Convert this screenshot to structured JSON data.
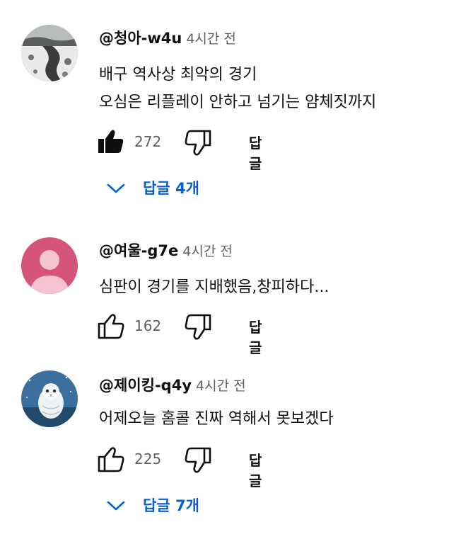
{
  "colors": {
    "text": "#0f0f0f",
    "meta": "#606060",
    "link": "#065fd4",
    "avatar2_bg": "#d4547a",
    "avatar3_bg": "#3b6f9e"
  },
  "comments": [
    {
      "handle": "@청아-w4u",
      "time": "4시간 전",
      "lines": [
        "배구 역사상 최악의 경기",
        "오심은 리플레이 안하고 넘기는 얌체짓까지"
      ],
      "likes": "272",
      "liked": true,
      "reply_label": "답글",
      "replies_label": "답글 4개",
      "avatar_icon": "snowy-landscape-avatar"
    },
    {
      "handle": "@여울-g7e",
      "time": "4시간 전",
      "lines": [
        "심판이 경기를 지배했음,창피하다..."
      ],
      "likes": "162",
      "liked": false,
      "reply_label": "답글",
      "avatar_icon": "default-person-avatar"
    },
    {
      "handle": "@제이킹-q4y",
      "time": "4시간 전",
      "lines": [
        "어제오늘 홈콜 진짜 역해서 못보겠다"
      ],
      "likes": "225",
      "liked": false,
      "reply_label": "답글",
      "replies_label": "답글 7개",
      "avatar_icon": "owl-avatar"
    }
  ]
}
